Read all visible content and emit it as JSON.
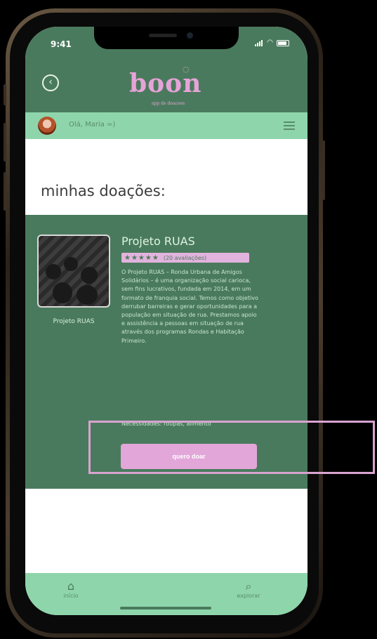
{
  "status_bar": {
    "time": "9:41"
  },
  "header": {
    "logo": "boon",
    "logo_subtitle": "app de doacoes"
  },
  "greeting": {
    "text": "Olá, Maria =)"
  },
  "page_title": "minhas doações:",
  "project": {
    "image_caption": "Projeto RUAS",
    "name": "Projeto RUAS",
    "stars": "★★★★★",
    "rating_text": "(20 avaliações)",
    "description": "O Projeto RUAS – Ronda Urbana de Amigos Solidários – é uma organização social carioca, sem fins lucrativos, fundada em 2014, em um formato de franquia social. Temos como objetivo derrubar barreiras e gerar oportunidades para a população em situação de rua. Prestamos apoio e assistência a pessoas em situação de rua através dos programas Rondas e Habitação Primeiro.",
    "needs": "Necessidades: roupas, alimento",
    "donate_button": "quero doar"
  },
  "bottom_nav": {
    "home_label": "início",
    "explore_label": "explorar"
  },
  "colors": {
    "primary_green": "#4a7a5d",
    "light_green": "#8ed5ab",
    "pink": "#e2a6d9"
  }
}
